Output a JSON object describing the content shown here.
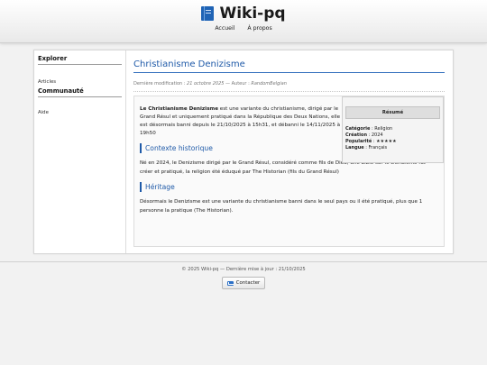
{
  "site": {
    "title": "Wiki-pq",
    "nav": [
      "Accueil",
      "À propos"
    ]
  },
  "sidebar": {
    "sections": [
      {
        "heading": "Explorer",
        "items": [
          "Articles"
        ]
      },
      {
        "heading": "Communauté",
        "items": [
          "Aide"
        ]
      }
    ]
  },
  "article": {
    "title": "Christianisme Denizisme",
    "meta_prefix": "Dernière modification : ",
    "meta_date": "21 octobre 2025",
    "meta_sep": " — Auteur : ",
    "meta_author": "RandomBelgian",
    "intro_bold": "Le Christianisme Denizisme",
    "intro_rest": " est une variante du christianisme, dirigé par le Grand Résul et uniquement pratiqué dans la République des Deux Nations, elle est désormais banni depuis le 21/10/2025 à 15h31, et débanni le 14/11/2025 à 19h50",
    "sections": [
      {
        "title": "Contexte historique",
        "text": "Né en 2024, le Denizisme dirigé par le Grand Résul, considéré comme fils de Dieu, une bible sur le Denizisme fut créer et pratiqué, la religion été éduqué par The Historian (fils du Grand Résul)"
      },
      {
        "title": "Héritage",
        "text": "Désormais le Denizisme est une variante du christianisme banni dans le seul pays ou il été pratiqué, plus que 1 personne la pratique (The Historian)."
      }
    ]
  },
  "infobox": {
    "title": "Résumé",
    "rows": [
      {
        "label": "Catégorie",
        "value": "Religion"
      },
      {
        "label": "Création",
        "value": "2024"
      },
      {
        "label": "Popularité",
        "value": "★★★★★"
      },
      {
        "label": "Langue",
        "value": "Français"
      }
    ]
  },
  "footer": {
    "text": "© 2025 Wiki-pq — Dernière mise à jour : 21/10/2025",
    "contact_label": "Contacter"
  },
  "colors": {
    "accent": "#1f5aa8",
    "background": "#f2f2f2"
  }
}
